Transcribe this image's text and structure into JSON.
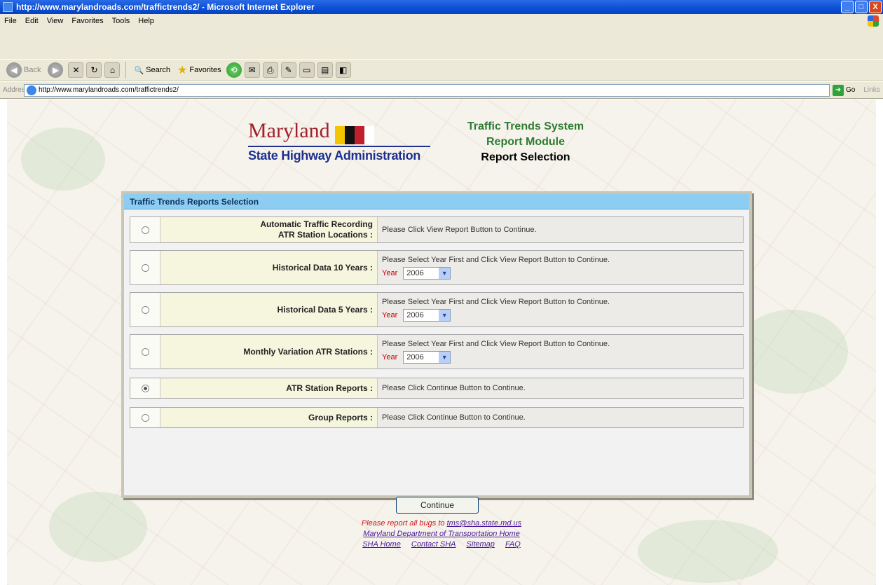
{
  "window": {
    "title": "http://www.marylandroads.com/traffictrends2/ - Microsoft Internet Explorer",
    "minimize": "_",
    "maximize": "□",
    "close": "X"
  },
  "menu": [
    "File",
    "Edit",
    "View",
    "Favorites",
    "Tools",
    "Help"
  ],
  "toolbar": {
    "back": "Back",
    "search": "Search",
    "favorites": "Favorites"
  },
  "address": {
    "label": "Address",
    "url": "http://www.marylandroads.com/traffictrends2/",
    "go": "Go",
    "links": "Links"
  },
  "page": {
    "logo_top": "Maryland",
    "logo_bottom": "State Highway Administration",
    "title_line1": "Traffic Trends System",
    "title_line2": "Report Module",
    "title_line3": "Report Selection",
    "panel_header": "Traffic Trends Reports Selection",
    "options": [
      {
        "label_line1": "Automatic Traffic Recording",
        "label_line2": "ATR Station Locations :",
        "desc": "Please Click View Report Button to Continue.",
        "selected": false
      },
      {
        "label": "Historical Data 10 Years :",
        "desc": "Please Select Year First and Click View Report Button to Continue.",
        "year_label": "Year",
        "year": "2006",
        "selected": false
      },
      {
        "label": "Historical Data 5 Years :",
        "desc": "Please Select Year First and Click View Report Button to Continue.",
        "year_label": "Year",
        "year": "2006",
        "selected": false
      },
      {
        "label": "Monthly Variation ATR Stations :",
        "desc": "Please Select Year First and Click View Report Button to Continue.",
        "year_label": "Year",
        "year": "2006",
        "selected": false
      },
      {
        "label": "ATR Station Reports :",
        "desc": "Please Click Continue Button to Continue.",
        "selected": true
      },
      {
        "label": "Group Reports :",
        "desc": "Please Click Continue Button to Continue.",
        "selected": false
      }
    ],
    "continue": "Continue",
    "footer": {
      "bug_text": "Please report all bugs to",
      "bug_email": "tms@sha.state.md.us",
      "mdot": "Maryland Department of Transportation Home",
      "links": [
        "SHA Home",
        "Contact SHA",
        "Sitemap",
        "FAQ"
      ]
    }
  },
  "colors": {
    "header_blue": "#8ecdf2",
    "label_bg": "#f6f5de",
    "title_green": "#2e7d32",
    "logo_red": "#a0212b",
    "logo_blue": "#1e2f8f"
  }
}
